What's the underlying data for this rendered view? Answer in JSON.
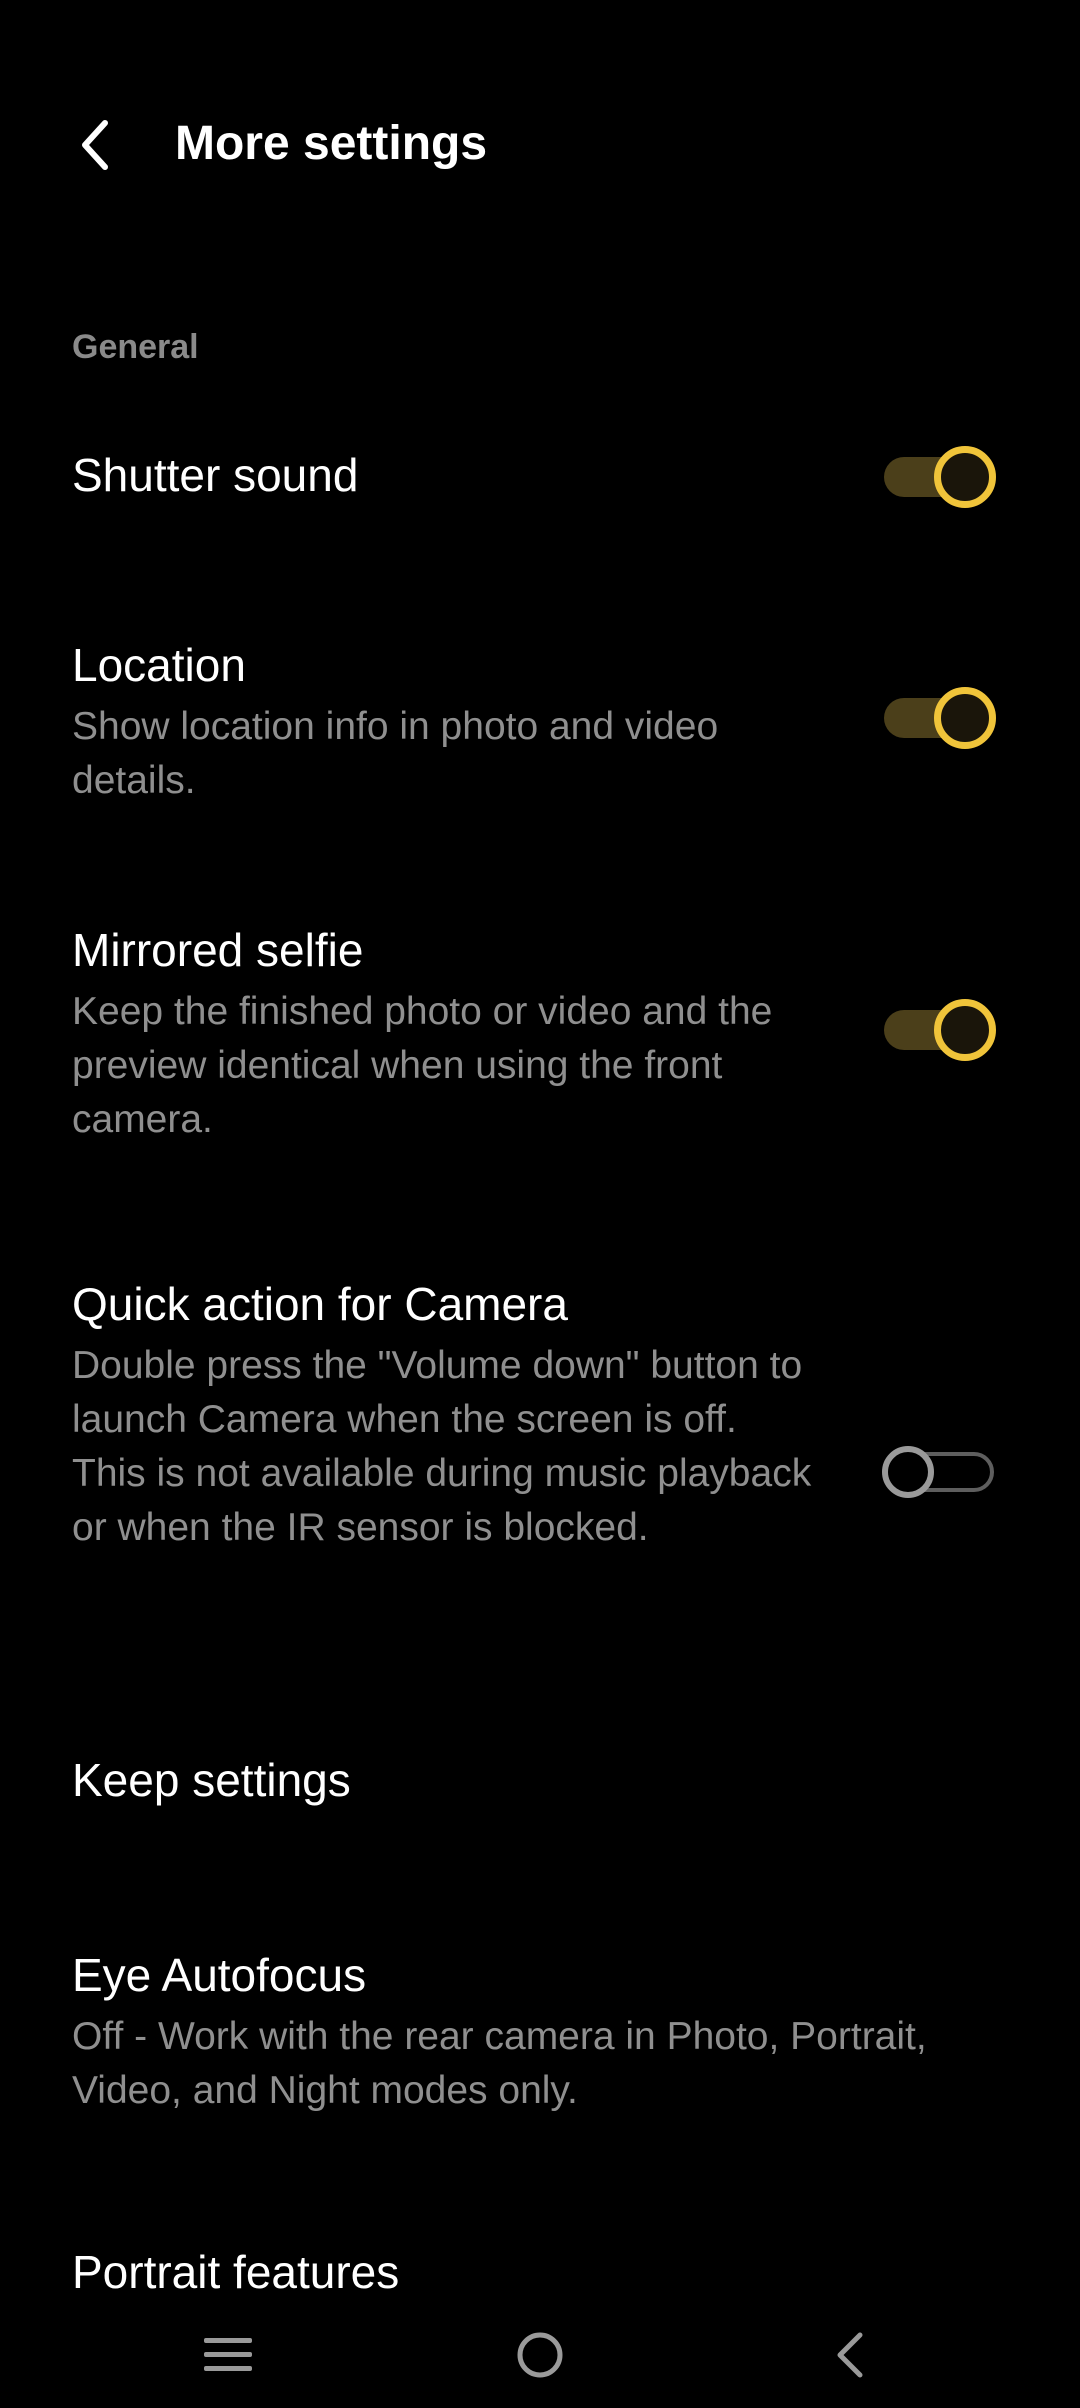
{
  "header": {
    "title": "More settings",
    "back_icon": "chevron-left-icon"
  },
  "section": {
    "label": "General"
  },
  "settings": [
    {
      "id": "shutter-sound",
      "title": "Shutter sound",
      "description": "",
      "toggle": true
    },
    {
      "id": "location",
      "title": "Location",
      "description": "Show location info in photo and video details.",
      "toggle": true
    },
    {
      "id": "mirrored-selfie",
      "title": "Mirrored selfie",
      "description": "Keep the finished photo or video and the preview identical when using the front camera.",
      "toggle": true
    },
    {
      "id": "quick-action",
      "title": "Quick action for Camera",
      "description": "Double press the \"Volume down\" button to launch Camera when the screen is off. This is not available during music playback or when the IR sensor is blocked.",
      "toggle": false
    },
    {
      "id": "keep-settings",
      "title": "Keep settings",
      "description": ""
    },
    {
      "id": "eye-autofocus",
      "title": "Eye Autofocus",
      "description": "Off - Work with the rear camera in Photo, Portrait, Video, and Night modes only."
    },
    {
      "id": "portrait-features",
      "title": "Portrait features",
      "description": ""
    }
  ],
  "navbar": {
    "menu_icon": "menu-icon",
    "home_icon": "home-circle-icon",
    "back_icon": "back-triangle-icon"
  },
  "colors": {
    "background": "#000000",
    "accent": "#f0c43a",
    "secondary_text": "#8f8f8f",
    "section_text": "#8a8a8a"
  }
}
